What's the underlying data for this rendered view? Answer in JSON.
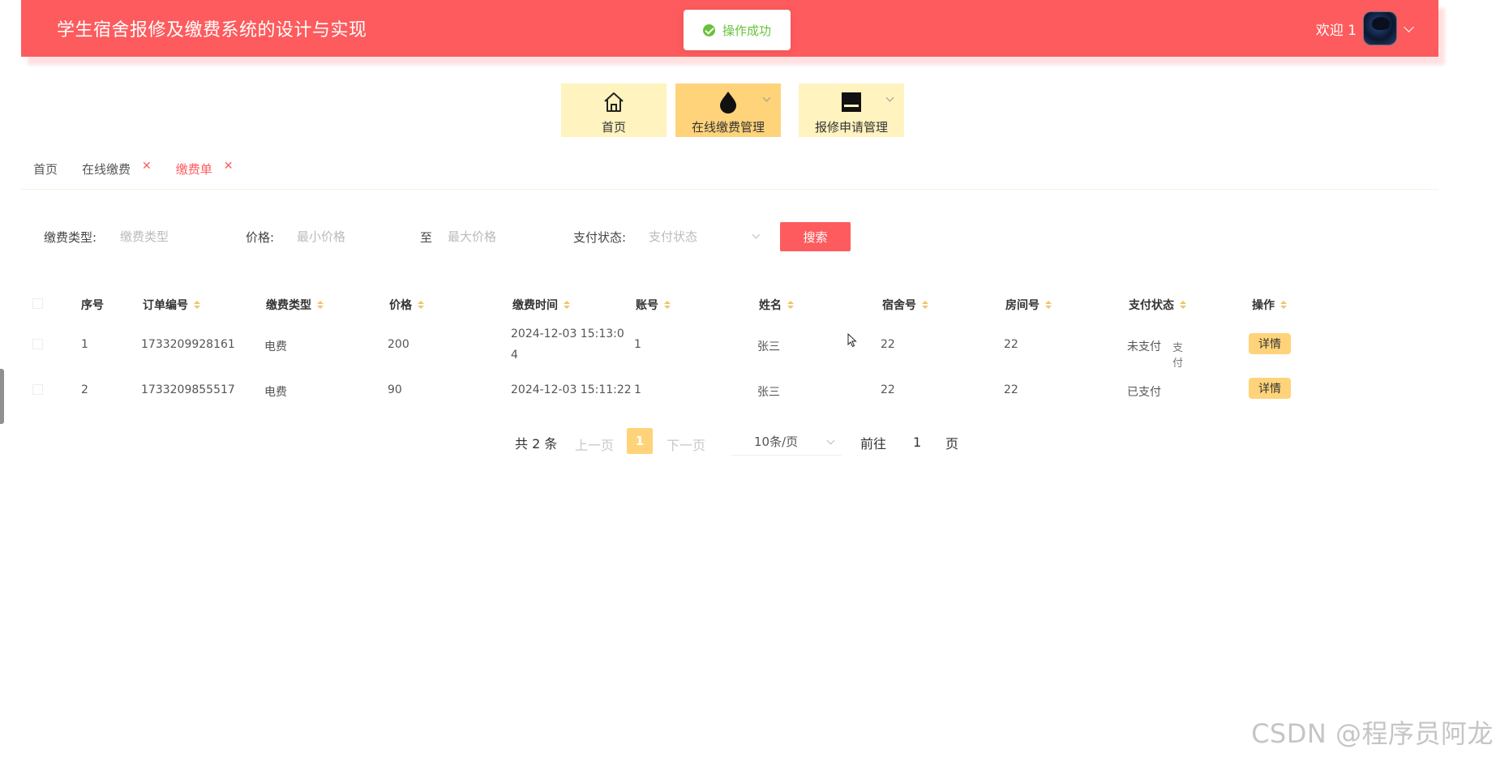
{
  "header": {
    "title": "学生宿舍报修及缴费系统的设计与实现",
    "welcome": "欢迎 1"
  },
  "toast": {
    "message": "操作成功"
  },
  "nav": {
    "items": [
      {
        "label": "首页",
        "icon": "home-icon"
      },
      {
        "label": "在线缴费管理",
        "icon": "drop-icon"
      },
      {
        "label": "报修申请管理",
        "icon": "form-icon"
      }
    ]
  },
  "tabs": [
    {
      "label": "首页"
    },
    {
      "label": "在线缴费"
    },
    {
      "label": "缴费单"
    }
  ],
  "search": {
    "fee_type_label": "缴费类型:",
    "fee_type_placeholder": "缴费类型",
    "price_label": "价格:",
    "min_price_placeholder": "最小价格",
    "to_label": "至",
    "max_price_placeholder": "最大价格",
    "status_label": "支付状态:",
    "status_placeholder": "支付状态",
    "search_button": "搜索"
  },
  "table": {
    "headers": [
      "序号",
      "订单编号",
      "缴费类型",
      "价格",
      "缴费时间",
      "账号",
      "姓名",
      "宿舍号",
      "房间号",
      "支付状态",
      "操作"
    ],
    "rows": [
      {
        "index": "1",
        "order_no": "1733209928161",
        "fee_type": "电费",
        "price": "200",
        "time_line1": "2024-12-03 15:13:0",
        "time_line2": "4",
        "account": "1",
        "name": "张三",
        "dorm": "22",
        "room": "22",
        "status": "未支付",
        "pay_action": "支付",
        "detail": "详情"
      },
      {
        "index": "2",
        "order_no": "1733209855517",
        "fee_type": "电费",
        "price": "90",
        "time_line1": "2024-12-03 15:11:22",
        "account": "1",
        "name": "张三",
        "dorm": "22",
        "room": "22",
        "status": "已支付",
        "detail": "详情"
      }
    ]
  },
  "pagination": {
    "total": "共 2 条",
    "prev": "上一页",
    "current": "1",
    "next": "下一页",
    "page_size": "10条/页",
    "goto_label": "前往",
    "goto_value": "1",
    "page_suffix": "页"
  },
  "watermark": "CSDN @程序员阿龙"
}
